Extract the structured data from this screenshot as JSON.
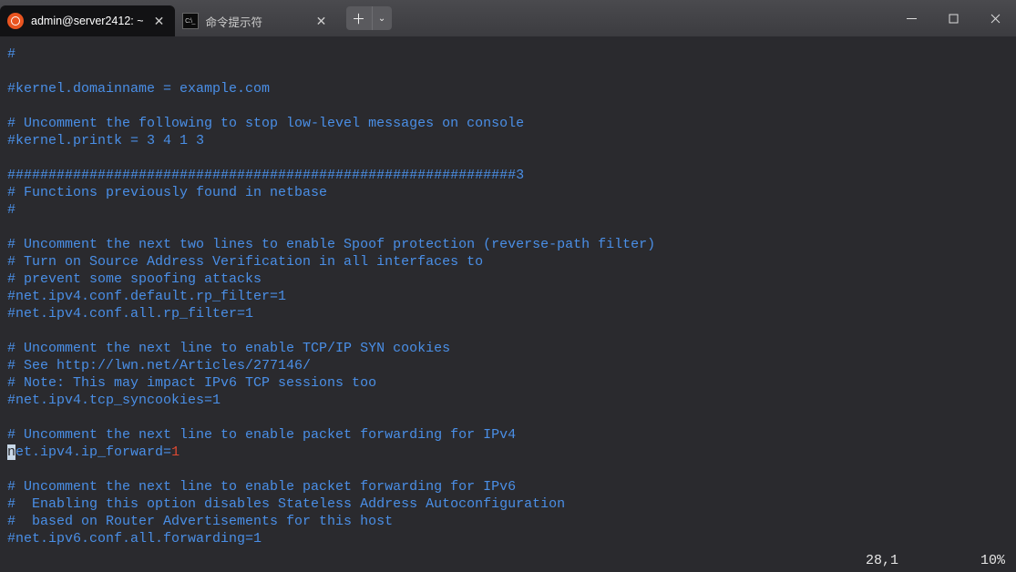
{
  "tabs": {
    "active": {
      "title": "admin@server2412: ~",
      "close": "✕"
    },
    "inactive": {
      "title": "命令提示符",
      "iconText": "C:\\_",
      "close": "✕"
    }
  },
  "newTab": {
    "plus": "＋",
    "chevron": "⌄"
  },
  "terminal": {
    "l1": "#",
    "l2": "",
    "l3": "#kernel.domainname = example.com",
    "l4": "",
    "l5": "# Uncomment the following to stop low-level messages on console",
    "l6": "#kernel.printk = 3 4 1 3",
    "l7": "",
    "l8": "##############################################################3",
    "l9": "# Functions previously found in netbase",
    "l10": "#",
    "l11": "",
    "l12": "# Uncomment the next two lines to enable Spoof protection (reverse-path filter)",
    "l13": "# Turn on Source Address Verification in all interfaces to",
    "l14": "# prevent some spoofing attacks",
    "l15": "#net.ipv4.conf.default.rp_filter=1",
    "l16": "#net.ipv4.conf.all.rp_filter=1",
    "l17": "",
    "l18": "# Uncomment the next line to enable TCP/IP SYN cookies",
    "l19": "# See http://lwn.net/Articles/277146/",
    "l20": "# Note: This may impact IPv6 TCP sessions too",
    "l21": "#net.ipv4.tcp_syncookies=1",
    "l22": "",
    "l23": "# Uncomment the next line to enable packet forwarding for IPv4",
    "fwd_cursor": "n",
    "fwd_text": "et.ipv4.ip_forward",
    "fwd_eq": "=",
    "fwd_val": "1",
    "l25": "",
    "l26": "# Uncomment the next line to enable packet forwarding for IPv6",
    "l27": "#  Enabling this option disables Stateless Address Autoconfiguration",
    "l28": "#  based on Router Advertisements for this host",
    "l29": "#net.ipv6.conf.all.forwarding=1"
  },
  "status": {
    "pos": "28,1",
    "pct": "10%"
  }
}
